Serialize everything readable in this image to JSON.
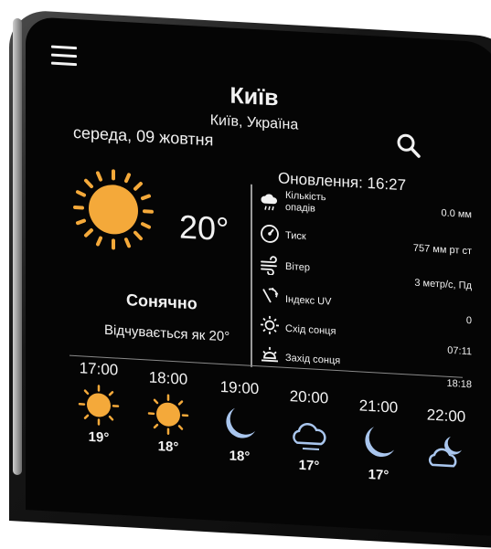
{
  "header": {
    "city": "Київ",
    "region": "Київ, Україна",
    "date": "середа, 09 жовтня",
    "updated": "Оновлення: 16:27"
  },
  "current": {
    "temperature": "20°",
    "condition": "Сонячно",
    "feels_like": "Відчувається як 20°",
    "icon": "sun-icon"
  },
  "details": [
    {
      "label": "Кількість опадів",
      "value": "0.0 мм",
      "icon": "rain-icon"
    },
    {
      "label": "Тиск",
      "value": "757 мм рт ст",
      "icon": "pressure-gauge-icon"
    },
    {
      "label": "Вітер",
      "value": "3 метр/с, Пд",
      "icon": "wind-icon"
    },
    {
      "label": "Індекс UV",
      "value": "0",
      "icon": "uv-icon"
    },
    {
      "label": "Схід сонця",
      "value": "07:11",
      "icon": "sunrise-icon"
    },
    {
      "label": "Захід сонця",
      "value": "18:18",
      "icon": "sunset-icon"
    }
  ],
  "hourly": [
    {
      "time": "17:00",
      "temp": "19°",
      "icon": "sun-icon"
    },
    {
      "time": "18:00",
      "temp": "18°",
      "icon": "sun-icon"
    },
    {
      "time": "19:00",
      "temp": "18°",
      "icon": "moon-icon"
    },
    {
      "time": "20:00",
      "temp": "17°",
      "icon": "cloud-icon"
    },
    {
      "time": "21:00",
      "temp": "17°",
      "icon": "moon-icon"
    },
    {
      "time": "22:00",
      "temp": "",
      "icon": "cloud-moon-icon"
    }
  ],
  "colors": {
    "sun": "#F4A93A",
    "moon": "#A9C6EE",
    "background": "#050505",
    "text": "#F2F2F2"
  }
}
